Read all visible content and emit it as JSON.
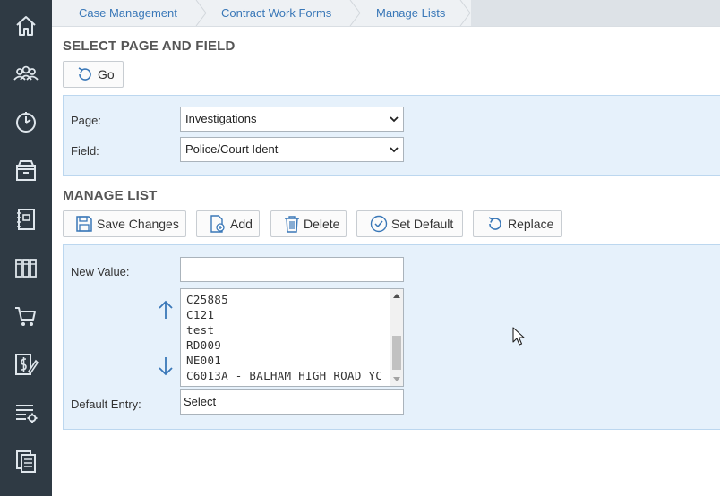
{
  "breadcrumb": [
    "Case Management",
    "Contract Work Forms",
    "Manage Lists"
  ],
  "sidebar": {
    "icons": [
      "home-icon",
      "people-icon",
      "dashboard-icon",
      "archive-icon",
      "notebook-icon",
      "library-icon",
      "cart-icon",
      "finance-icon",
      "list-settings-icon",
      "documents-icon"
    ]
  },
  "select_section": {
    "title": "SELECT PAGE AND FIELD",
    "go_label": "Go",
    "page_label": "Page:",
    "page_value": "Investigations",
    "field_label": "Field:",
    "field_value": "Police/Court Ident"
  },
  "manage_section": {
    "title": "MANAGE LIST",
    "buttons": {
      "save": "Save Changes",
      "add": "Add",
      "delete": "Delete",
      "set_default": "Set Default",
      "replace": "Replace"
    },
    "new_value_label": "New Value:",
    "new_value": "",
    "list_items": [
      "C25885",
      "C121",
      "test",
      "RD009",
      "NE001",
      "C6013A - BALHAM HIGH ROAD YC"
    ],
    "default_entry_label": "Default Entry:",
    "default_entry_value": "Select"
  },
  "colors": {
    "sidebar": "#2f3a44",
    "accent": "#3a78b8",
    "panel": "#e6f1fb"
  }
}
